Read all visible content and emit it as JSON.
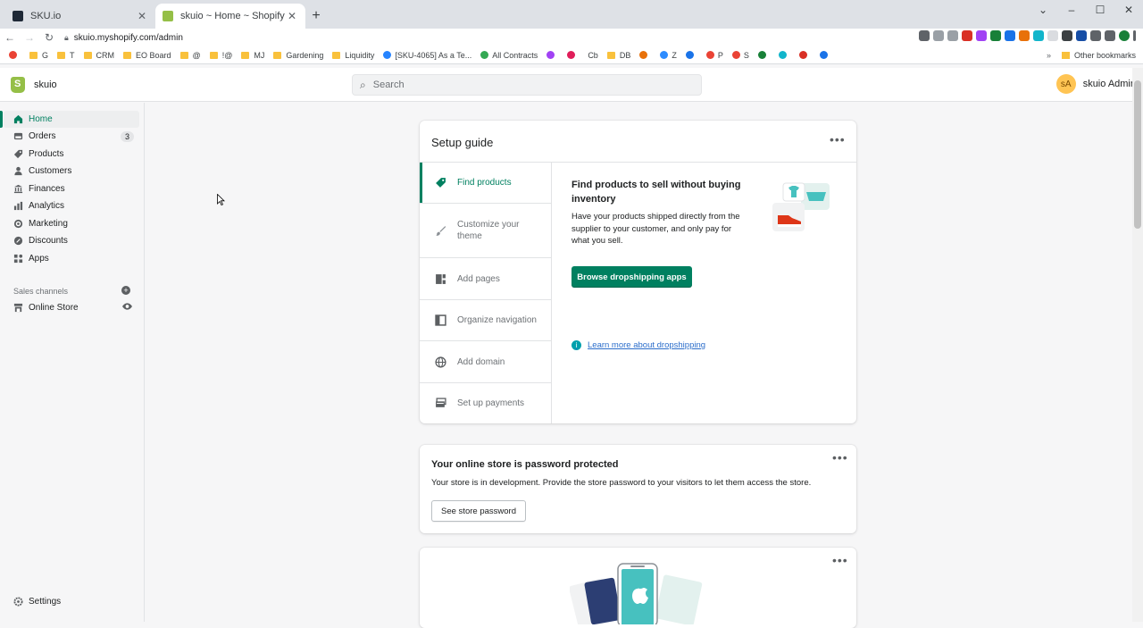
{
  "browser": {
    "tabs": [
      {
        "title": "SKU.io",
        "active": false,
        "favicon_color": "#1f2937"
      },
      {
        "title": "skuio ~ Home ~ Shopify",
        "active": true,
        "favicon_color": "#95bf47"
      }
    ],
    "url": "skuio.myshopify.com/admin",
    "bookmarks": [
      {
        "label": "G",
        "type": "folder"
      },
      {
        "label": "T",
        "type": "folder"
      },
      {
        "label": "CRM",
        "type": "folder"
      },
      {
        "label": "EO Board",
        "type": "folder"
      },
      {
        "label": "@",
        "type": "folder"
      },
      {
        "label": "!@",
        "type": "folder"
      },
      {
        "label": "MJ",
        "type": "folder"
      },
      {
        "label": "Gardening",
        "type": "folder"
      },
      {
        "label": "Liquidity",
        "type": "folder"
      },
      {
        "label": "[SKU-4065] As a Te...",
        "type": "site",
        "color": "#2684ff"
      },
      {
        "label": "All Contracts",
        "type": "site",
        "color": "#34a853"
      },
      {
        "label": "Cb",
        "type": "site",
        "color": "#555555"
      },
      {
        "label": "DB",
        "type": "folder"
      },
      {
        "label": "Z",
        "type": "site",
        "color": "#2d8cff"
      },
      {
        "label": "P",
        "type": "site",
        "color": "#ea4335"
      },
      {
        "label": "S",
        "type": "site",
        "color": "#ea4335"
      }
    ],
    "other_bookmarks": "Other bookmarks",
    "profile_initial": "K"
  },
  "shopify": {
    "store_name": "skuio",
    "search_placeholder": "Search",
    "user_initials": "sA",
    "user_name": "skuio Admin"
  },
  "sidebar": {
    "items": [
      {
        "label": "Home",
        "icon": "home-icon",
        "active": true
      },
      {
        "label": "Orders",
        "icon": "orders-icon",
        "badge": "3"
      },
      {
        "label": "Products",
        "icon": "tag-icon"
      },
      {
        "label": "Customers",
        "icon": "person-icon"
      },
      {
        "label": "Finances",
        "icon": "bank-icon"
      },
      {
        "label": "Analytics",
        "icon": "bar-chart-icon"
      },
      {
        "label": "Marketing",
        "icon": "target-icon"
      },
      {
        "label": "Discounts",
        "icon": "discount-icon"
      },
      {
        "label": "Apps",
        "icon": "apps-icon"
      }
    ],
    "sales_channels_title": "Sales channels",
    "online_store": "Online Store",
    "settings": "Settings"
  },
  "setup_guide": {
    "title": "Setup guide",
    "steps": [
      {
        "label": "Find products",
        "active": true
      },
      {
        "label": "Customize your theme"
      },
      {
        "label": "Add pages"
      },
      {
        "label": "Organize navigation"
      },
      {
        "label": "Add domain"
      },
      {
        "label": "Set up payments"
      }
    ],
    "detail_heading": "Find products to sell without buying inventory",
    "detail_text": "Have your products shipped directly from the supplier to your customer, and only pay for what you sell.",
    "primary_button": "Browse dropshipping apps",
    "learn_link": "Learn more about dropshipping"
  },
  "password_card": {
    "title": "Your online store is password protected",
    "text": "Your store is in development. Provide the store password to your visitors to let them access the store.",
    "button": "See store password"
  },
  "colors": {
    "accent": "#008060",
    "link": "#2c6ecb",
    "brand": "#95bf47"
  }
}
